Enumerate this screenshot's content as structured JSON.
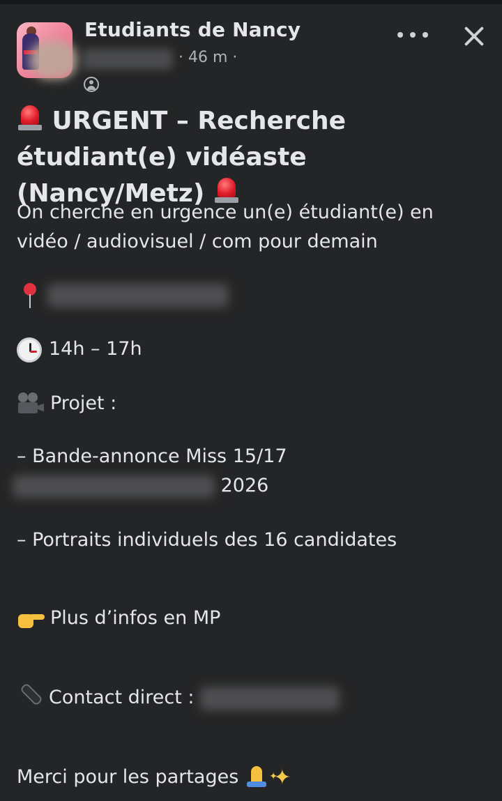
{
  "post": {
    "group_name": "Etudiants de Nancy",
    "time": "· 46 m ·",
    "title": "URGENT – Recherche étudiant(e) vidéaste (Nancy/Metz)",
    "lines": {
      "intro": "On cherche en urgence un(e) étudiant(e) en vidéo / audiovisuel / com pour demain",
      "hours": "14h – 17h",
      "project_label": "Projet :",
      "item1_a": "– Bande-annonce Miss 15/17",
      "item1_b": "2026",
      "item2": "– Portraits individuels des 16 candidates",
      "more_info": "Plus d’infos en MP",
      "contact": "Contact direct :",
      "thanks": "Merci pour les partages"
    }
  },
  "icons": {
    "siren": "police-car-light-icon",
    "pin": "round-pushpin-icon",
    "clock": "clock-icon",
    "camera": "movie-camera-icon",
    "hand": "pointing-hand-icon",
    "phone": "telephone-receiver-icon",
    "pray": "folded-hands-icon",
    "sparkles": "sparkles-icon",
    "more": "more-options-icon",
    "close": "close-icon"
  },
  "colors": {
    "background": "#242526",
    "text": "#e4e6eb",
    "secondary_text": "#b0b3b8"
  }
}
